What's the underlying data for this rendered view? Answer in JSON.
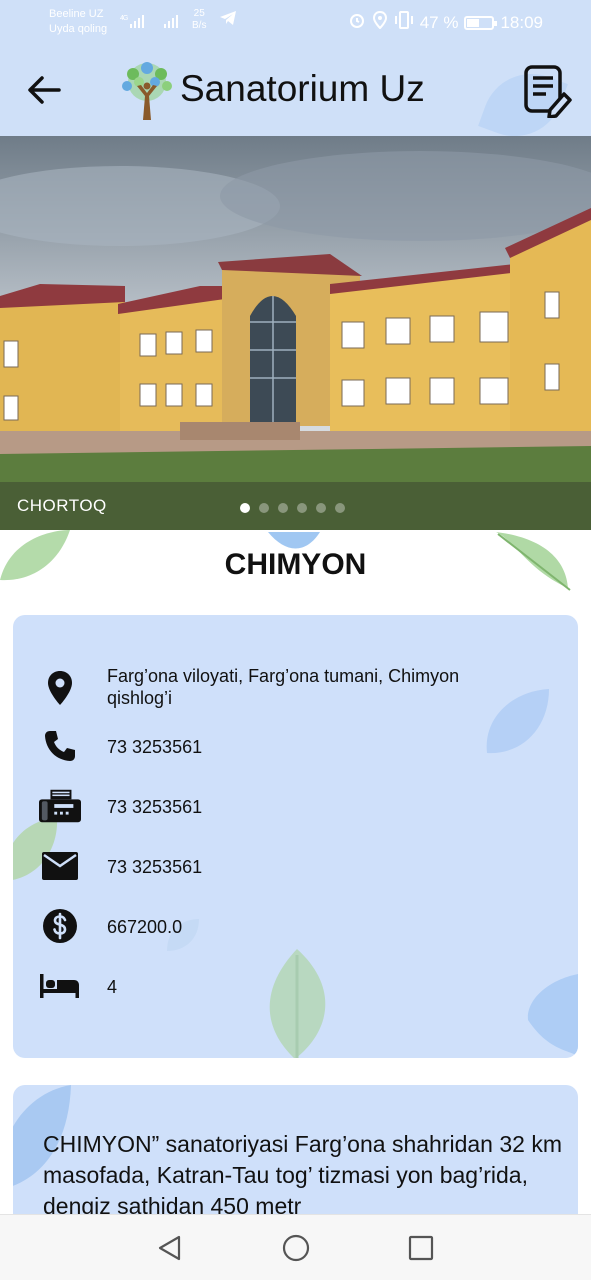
{
  "status_bar": {
    "carrier": "Beeline UZ",
    "carrier_sub": "Uyda qoling",
    "net_type": "4G",
    "speed_value": "25",
    "speed_unit": "B/s",
    "battery": "47 %",
    "time": "18:09"
  },
  "header": {
    "title": "Sanatorium Uz"
  },
  "carousel": {
    "caption": "CHORTOQ",
    "slide_count": 6,
    "active_index": 0
  },
  "sanatorium": {
    "name": "CHIMYON",
    "address": "Farg’ona viloyati, Farg’ona tumani, Chimyon qishlog’i",
    "phone": "73 3253561",
    "fax": "73 3253561",
    "email": "73 3253561",
    "price": "667200.0",
    "beds": "4",
    "description": "CHIMYON” sanatoriyasi Farg’ona shahridan 32 km masofada, Katran-Tau tog’ tizmasi yon bag’rida, dengiz sathidan 450 metr"
  },
  "icons": {
    "back": "arrow-left-icon",
    "notes": "notes-edit-icon",
    "address": "location-pin-icon",
    "phone": "phone-icon",
    "fax": "fax-icon",
    "email": "mail-icon",
    "price": "dollar-icon",
    "beds": "bed-icon"
  },
  "colors": {
    "header_bg": "#cfe0f8",
    "card_bg": "#cfe0fa",
    "leaf_green": "#a7d59b",
    "leaf_blue": "#b9d3f5"
  }
}
